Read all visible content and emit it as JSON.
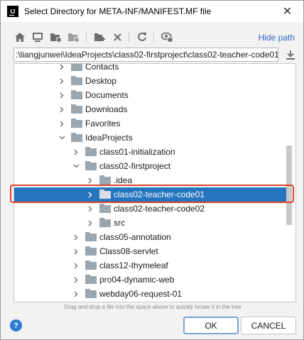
{
  "window": {
    "title": "Select Directory for META-INF/MANIFEST.MF file",
    "app_icon_text": "IJ",
    "close_glyph": "✕"
  },
  "toolbar": {
    "hide_path_label": "Hide path",
    "icons": [
      "home-icon",
      "desktop-icon",
      "project-folder-icon",
      "module-folder-icon",
      "new-folder-icon",
      "delete-icon",
      "refresh-icon",
      "show-hidden-icon"
    ]
  },
  "path": {
    "value": ":\\liangjunwei\\IdeaProjects\\class02-firstproject\\class02-teacher-code01"
  },
  "tree": {
    "rows": [
      {
        "label": "Contacts",
        "level": 0,
        "expanded": false,
        "selected": false
      },
      {
        "label": "Desktop",
        "level": 0,
        "expanded": false,
        "selected": false
      },
      {
        "label": "Documents",
        "level": 0,
        "expanded": false,
        "selected": false
      },
      {
        "label": "Downloads",
        "level": 0,
        "expanded": false,
        "selected": false
      },
      {
        "label": "Favorites",
        "level": 0,
        "expanded": false,
        "selected": false
      },
      {
        "label": "IdeaProjects",
        "level": 0,
        "expanded": true,
        "selected": false
      },
      {
        "label": "class01-initialization",
        "level": 1,
        "expanded": false,
        "selected": false
      },
      {
        "label": "class02-firstproject",
        "level": 1,
        "expanded": true,
        "selected": false
      },
      {
        "label": ".idea",
        "level": 2,
        "expanded": false,
        "selected": false
      },
      {
        "label": "class02-teacher-code01",
        "level": 2,
        "expanded": false,
        "selected": true
      },
      {
        "label": "class02-teacher-code02",
        "level": 2,
        "expanded": false,
        "selected": false
      },
      {
        "label": "src",
        "level": 2,
        "expanded": false,
        "selected": false
      },
      {
        "label": "class05-annotation",
        "level": 1,
        "expanded": false,
        "selected": false
      },
      {
        "label": "Class08-servlet",
        "level": 1,
        "expanded": false,
        "selected": false
      },
      {
        "label": "class12-thymeleaf",
        "level": 1,
        "expanded": false,
        "selected": false
      },
      {
        "label": "pro04-dynamic-web",
        "level": 1,
        "expanded": false,
        "selected": false
      },
      {
        "label": "webday06-request-01",
        "level": 1,
        "expanded": false,
        "selected": false
      }
    ]
  },
  "hint": "Drag and drop a file into the space above to quickly locate it in the tree",
  "footer": {
    "help_glyph": "?",
    "ok_label": "OK",
    "cancel_label": "CANCEL"
  },
  "colors": {
    "selection": "#2675bf",
    "highlight_border": "#e0402a",
    "link": "#2f65ca",
    "folder": "#9aa7b0"
  }
}
